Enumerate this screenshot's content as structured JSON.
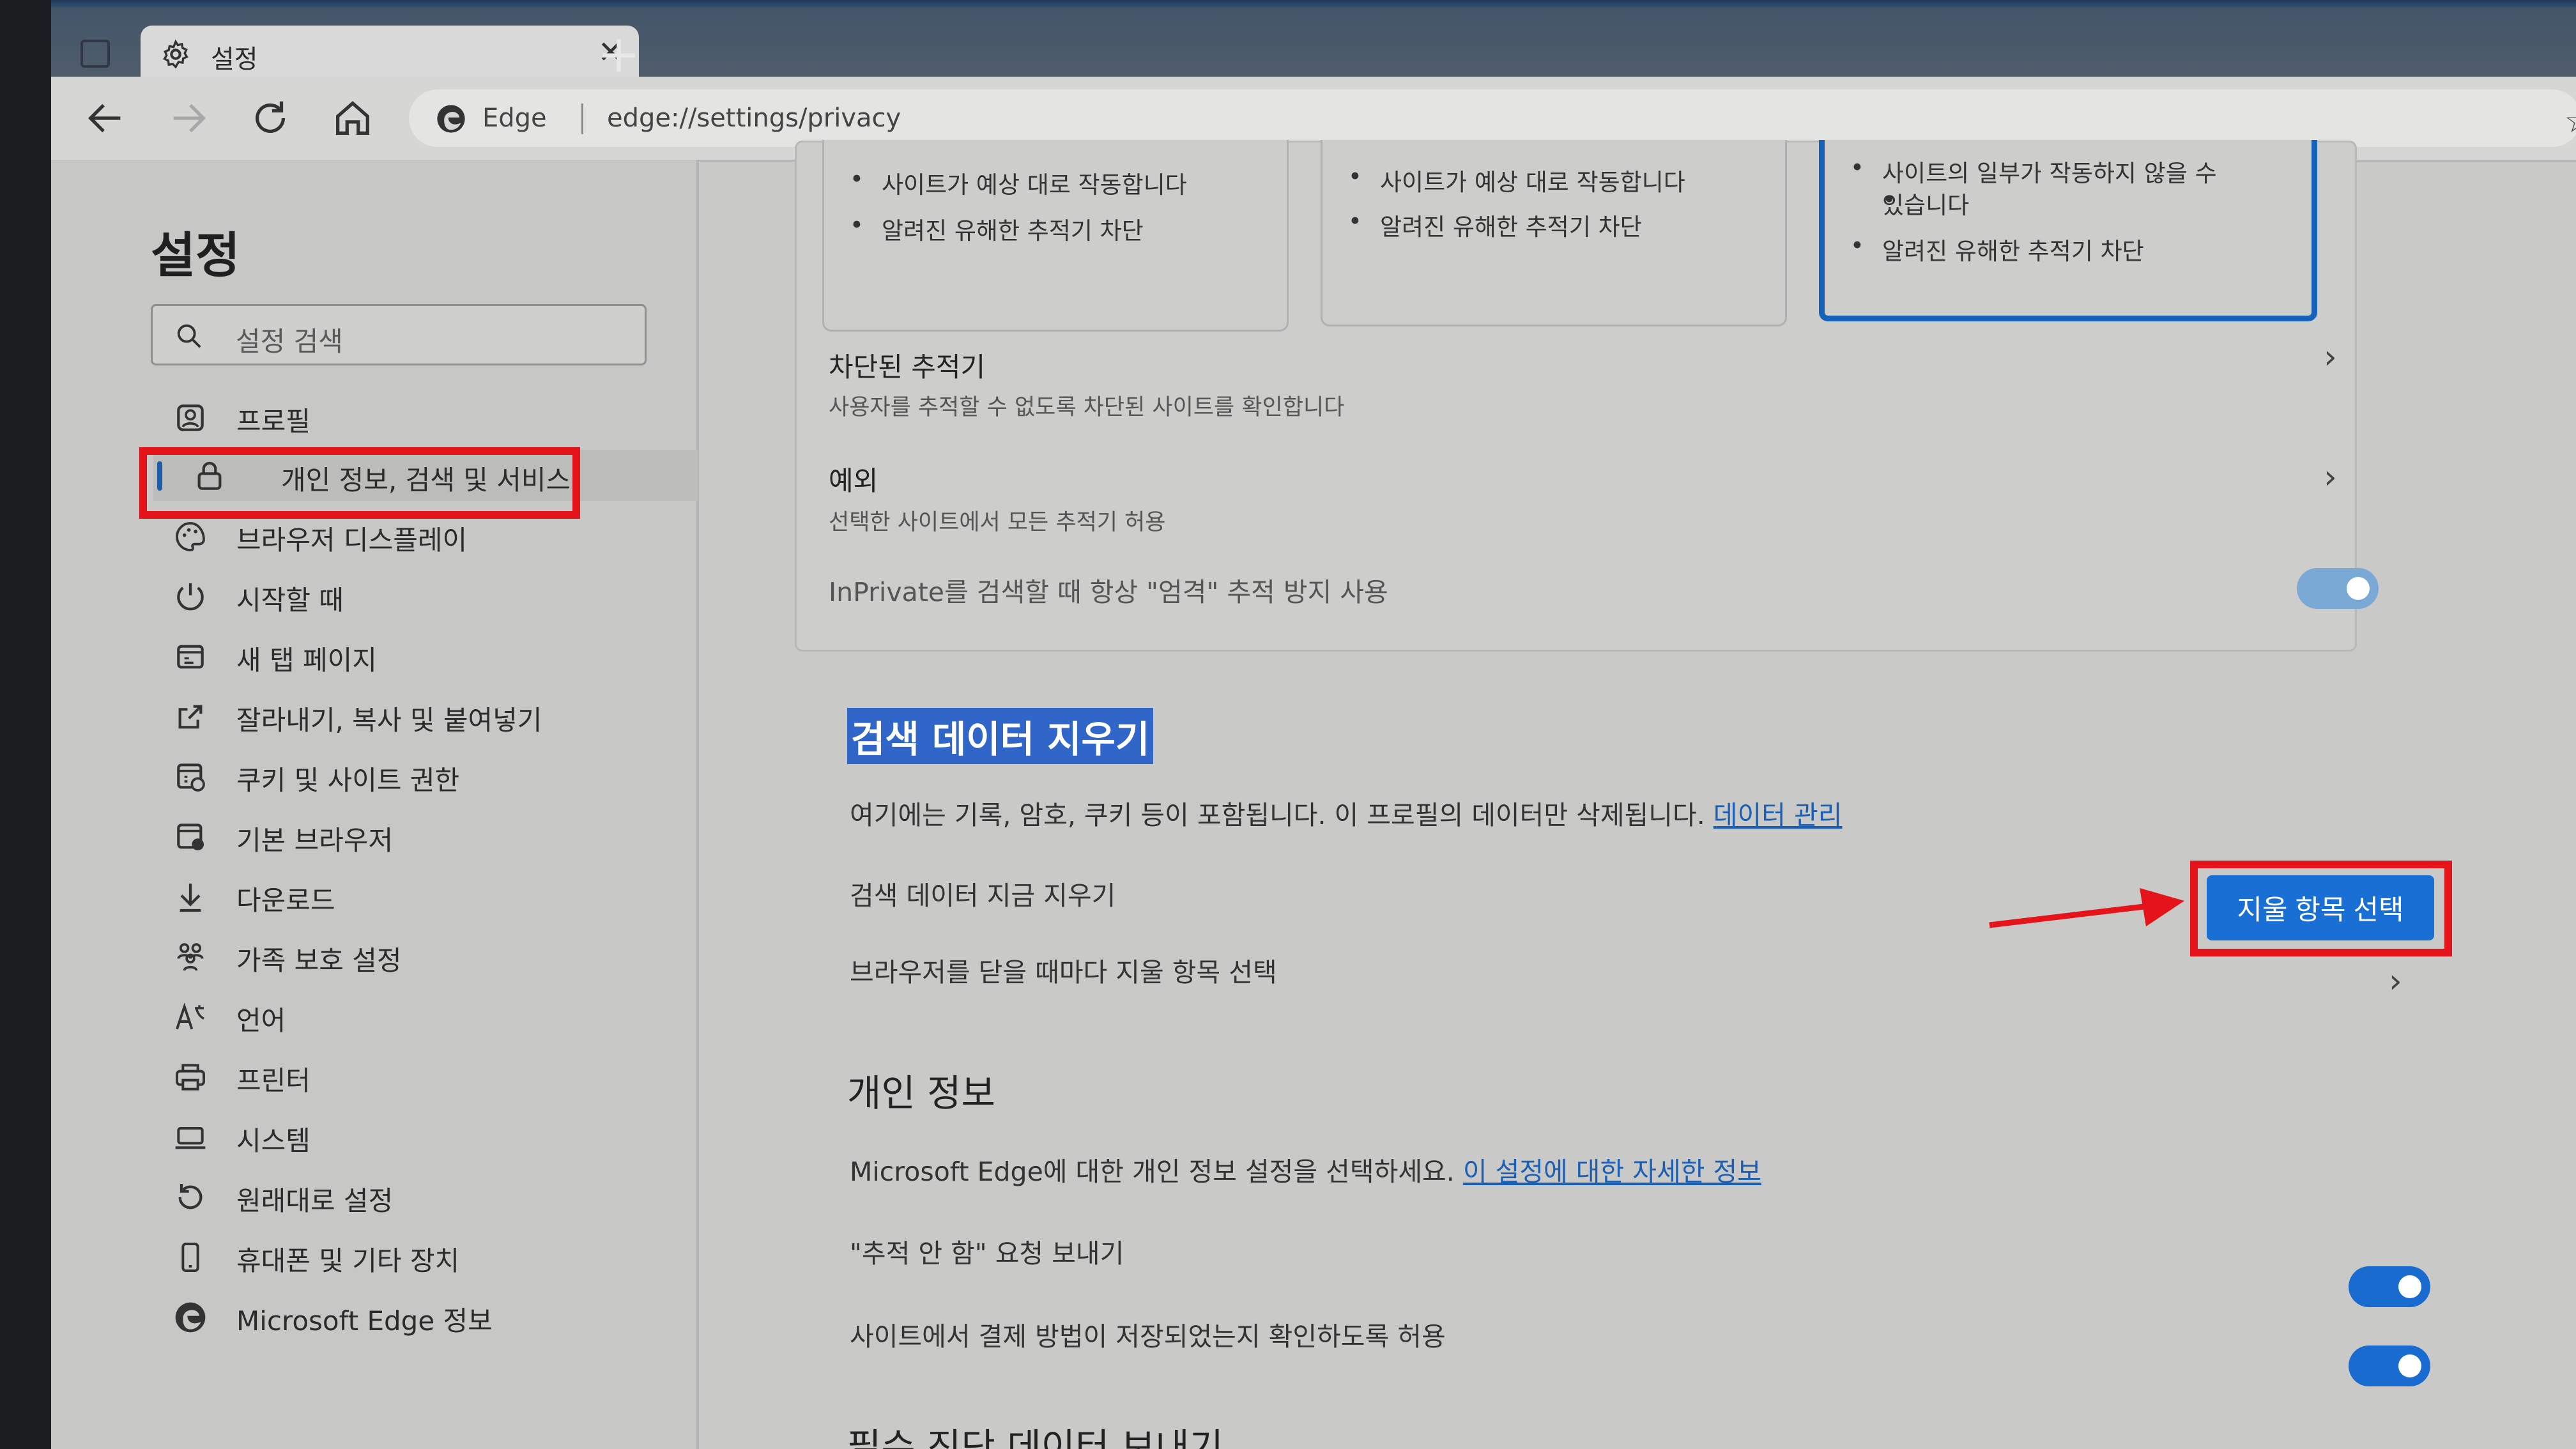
{
  "tab": {
    "title": "설정"
  },
  "address": {
    "brand": "Edge",
    "url": "edge://settings/privacy"
  },
  "sidebar": {
    "title": "설정",
    "search_placeholder": "설정 검색",
    "items": [
      {
        "label": "프로필",
        "icon": "profile-icon"
      },
      {
        "label": "개인 정보, 검색 및 서비스",
        "icon": "lock-icon",
        "active": true
      },
      {
        "label": "브라우저 디스플레이",
        "icon": "palette-icon"
      },
      {
        "label": "시작할 때",
        "icon": "power-icon"
      },
      {
        "label": "새 탭 페이지",
        "icon": "new-tab-icon"
      },
      {
        "label": "잘라내기, 복사 및 붙여넣기",
        "icon": "share-icon"
      },
      {
        "label": "쿠키 및 사이트 권한",
        "icon": "cookie-icon"
      },
      {
        "label": "기본 브라우저",
        "icon": "default-browser-icon"
      },
      {
        "label": "다운로드",
        "icon": "download-icon"
      },
      {
        "label": "가족 보호 설정",
        "icon": "family-icon"
      },
      {
        "label": "언어",
        "icon": "language-icon"
      },
      {
        "label": "프린터",
        "icon": "printer-icon"
      },
      {
        "label": "시스템",
        "icon": "system-icon"
      },
      {
        "label": "원래대로 설정",
        "icon": "reset-icon"
      },
      {
        "label": "휴대폰 및 기타 장치",
        "icon": "phone-icon"
      },
      {
        "label": "Microsoft Edge 정보",
        "icon": "edge-icon"
      }
    ]
  },
  "tracking": {
    "cards": [
      {
        "bullets": [
          "사이트가 예상 대로 작동합니다",
          "알려진 유해한 추적기 차단"
        ]
      },
      {
        "bullets": [
          "사이트가 예상 대로 작동합니다",
          "알려진 유해한 추적기 차단"
        ]
      },
      {
        "bullets": [
          "사이트의 일부가 작동하지 않을 수",
          "있습니다",
          "알려진 유해한 추적기 차단"
        ],
        "selected": true
      }
    ],
    "blocked_title": "차단된 추적기",
    "blocked_sub": "사용자를 추적할 수 없도록 차단된 사이트를 확인합니다",
    "exceptions_title": "예외",
    "exceptions_sub": "선택한 사이트에서 모든 추적기 허용",
    "inprivate_label": "InPrivate를 검색할 때 항상 \"엄격\" 추적 방지 사용",
    "inprivate_on": true
  },
  "clear_data": {
    "heading": "검색 데이터 지우기",
    "description": "여기에는 기록, 암호, 쿠키 등이 포함됩니다. 이 프로필의 데이터만 삭제됩니다.",
    "manage_link": "데이터 관리",
    "clear_now_label": "검색 데이터 지금 지우기",
    "button_label": "지울 항목 선택",
    "on_close_label": "브라우저를 닫을 때마다 지울 항목 선택"
  },
  "privacy": {
    "heading": "개인 정보",
    "description": "Microsoft Edge에 대한 개인 정보 설정을 선택하세요.",
    "learn_link": "이 설정에 대한 자세한 정보",
    "dnt_label": "\"추적 안 함\" 요청 보내기",
    "dnt_on": true,
    "payment_label": "사이트에서 결제 방법이 저장되었는지 확인하도록 허용",
    "payment_on": true,
    "next_heading_partial": "필수 진단 데이터 보내기"
  },
  "colors": {
    "accent": "#1a6fd4",
    "annotation_red": "#e5141b"
  }
}
